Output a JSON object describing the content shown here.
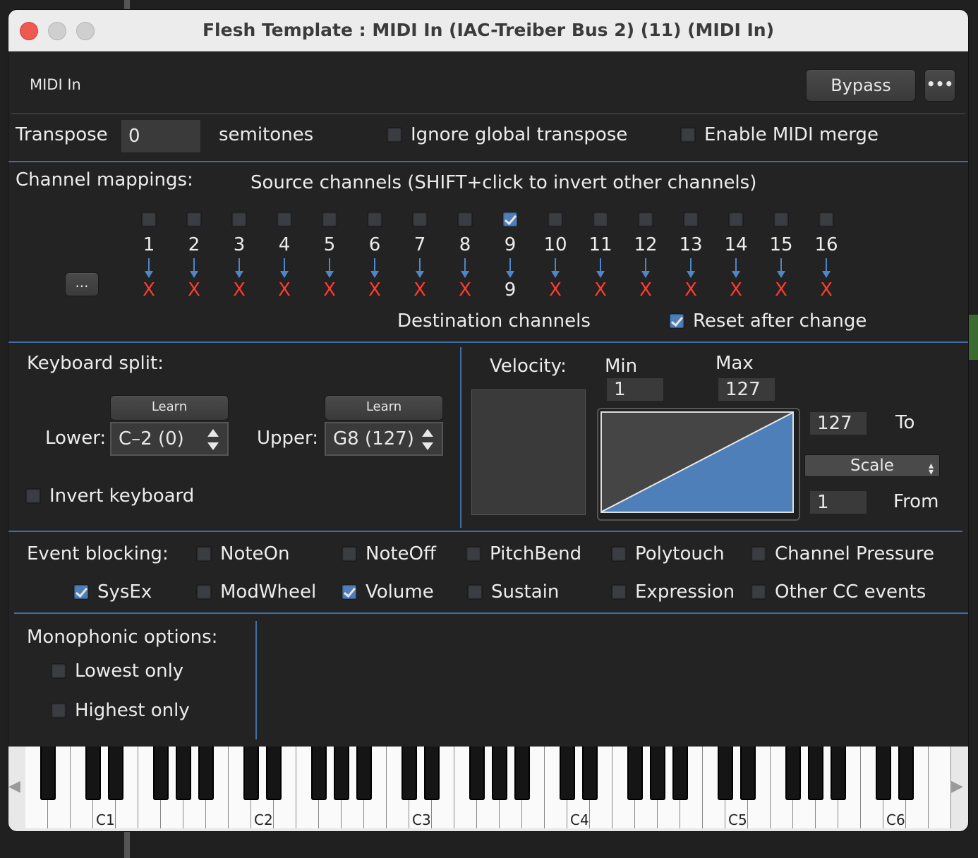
{
  "window": {
    "title": "Flesh Template : MIDI In (IAC-Treiber Bus 2) (11) (MIDI In)"
  },
  "header": {
    "plugin_name": "MIDI In",
    "bypass_label": "Bypass",
    "more_label": "•••"
  },
  "transpose": {
    "label": "Transpose",
    "value": "0",
    "unit": "semitones",
    "ignore_global_label": "Ignore global transpose",
    "ignore_global_checked": false,
    "merge_label": "Enable MIDI merge",
    "merge_checked": false
  },
  "channels": {
    "title": "Channel mappings:",
    "source_label": "Source channels (SHIFT+click to invert other channels)",
    "dest_label": "Destination channels",
    "reset_label": "Reset after change",
    "reset_checked": true,
    "more_label": "...",
    "sources": [
      "1",
      "2",
      "3",
      "4",
      "5",
      "6",
      "7",
      "8",
      "9",
      "10",
      "11",
      "12",
      "13",
      "14",
      "15",
      "16"
    ],
    "checked": [
      false,
      false,
      false,
      false,
      false,
      false,
      false,
      false,
      true,
      false,
      false,
      false,
      false,
      false,
      false,
      false
    ],
    "dests": [
      "X",
      "X",
      "X",
      "X",
      "X",
      "X",
      "X",
      "X",
      "9",
      "X",
      "X",
      "X",
      "X",
      "X",
      "X",
      "X"
    ]
  },
  "split": {
    "title": "Keyboard split:",
    "learn_label": "Learn",
    "lower_label": "Lower:",
    "lower_value": "C–2 (0)",
    "upper_label": "Upper:",
    "upper_value": "G8 (127)",
    "invert_label": "Invert keyboard"
  },
  "velocity": {
    "title": "Velocity:",
    "min_label": "Min",
    "min_value": "1",
    "max_label": "Max",
    "max_value": "127",
    "to_value": "127",
    "to_label": "To",
    "mode": "Scale",
    "from_value": "1",
    "from_label": "From"
  },
  "events": {
    "title": "Event blocking:",
    "items": [
      {
        "label": "NoteOn",
        "checked": false
      },
      {
        "label": "NoteOff",
        "checked": false
      },
      {
        "label": "PitchBend",
        "checked": false
      },
      {
        "label": "Polytouch",
        "checked": false
      },
      {
        "label": "Channel Pressure",
        "checked": false
      },
      {
        "label": "SysEx",
        "checked": true
      },
      {
        "label": "ModWheel",
        "checked": false
      },
      {
        "label": "Volume",
        "checked": true
      },
      {
        "label": "Sustain",
        "checked": false
      },
      {
        "label": "Expression",
        "checked": false
      },
      {
        "label": "Other CC events",
        "checked": false
      }
    ]
  },
  "mono": {
    "title": "Monophonic options:",
    "lowest_label": "Lowest only",
    "highest_label": "Highest only"
  },
  "keyboard": {
    "octave_labels": [
      "C1",
      "C2",
      "C3",
      "C4",
      "C5",
      "C6"
    ],
    "left_arrow": "◀",
    "right_arrow": "▶"
  },
  "colors": {
    "accent": "#4f7fb8",
    "separator": "#3f6da6",
    "x_mark": "#ff3b30",
    "close": "#ee5a52"
  }
}
